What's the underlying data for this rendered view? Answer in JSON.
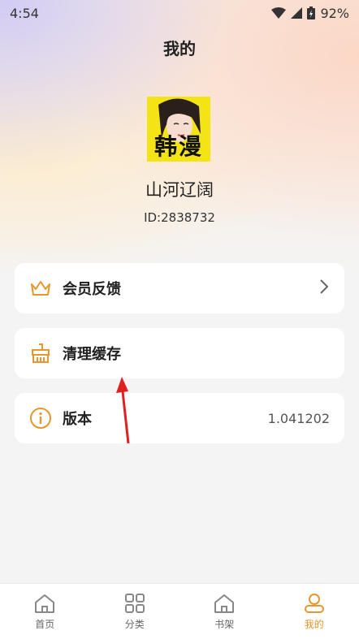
{
  "status_bar": {
    "time": "4:54",
    "battery": "92%"
  },
  "header": {
    "title": "我的"
  },
  "profile": {
    "avatar_text": "韩漫",
    "nickname": "山河辽阔",
    "user_id": "ID:2838732"
  },
  "menu": [
    {
      "label": "会员反馈",
      "icon": "crown-icon",
      "trailing": "chevron-right-icon"
    },
    {
      "label": "清理缓存",
      "icon": "broom-icon"
    },
    {
      "label": "版本",
      "icon": "info-icon",
      "value": "1.041202"
    }
  ],
  "tabbar": {
    "items": [
      {
        "label": "首页",
        "icon": "home-icon",
        "active": false
      },
      {
        "label": "分类",
        "icon": "grid-icon",
        "active": false
      },
      {
        "label": "书架",
        "icon": "bookshelf-icon",
        "active": false
      },
      {
        "label": "我的",
        "icon": "user-icon",
        "active": true
      }
    ]
  },
  "colors": {
    "accent": "#e8962e",
    "annotation_arrow": "#e02020"
  }
}
